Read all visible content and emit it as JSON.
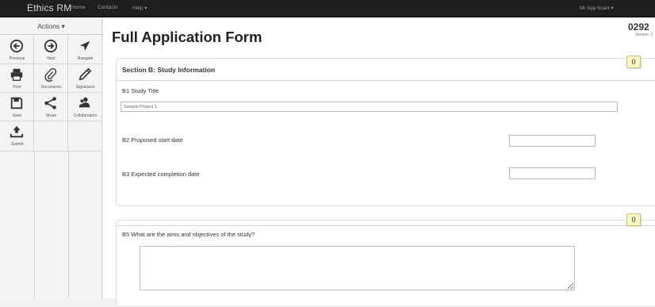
{
  "navbar": {
    "brand": "Ethics RM",
    "links": [
      "Home",
      "Contacts",
      "Help ▾"
    ],
    "user": "Mr App licant ▾"
  },
  "sidebar": {
    "actions_label": "Actions ▾",
    "buttons": [
      {
        "label": "Previous",
        "icon": "arrow-left-circle-icon"
      },
      {
        "label": "Next",
        "icon": "arrow-right-circle-icon"
      },
      {
        "label": "Navigate",
        "icon": "location-arrow-icon"
      },
      {
        "label": "Print",
        "icon": "print-icon"
      },
      {
        "label": "Documents",
        "icon": "paperclip-icon"
      },
      {
        "label": "Signatures",
        "icon": "pencil-icon"
      },
      {
        "label": "Save",
        "icon": "floppy-disk-icon"
      },
      {
        "label": "Share",
        "icon": "share-icon"
      },
      {
        "label": "Collaborators",
        "icon": "collaborators-icon"
      },
      {
        "label": "Submit",
        "icon": "upload-icon"
      }
    ]
  },
  "page": {
    "title": "Full Application Form",
    "app_id": "0292",
    "version": "Version: 2"
  },
  "section_b": {
    "title": "Section B: Study Information",
    "badge": "0",
    "b1_label": "B1  Study Title",
    "b1_value": "Sample Project 1",
    "b2_label": "B2  Proposed start date",
    "b2_value": "",
    "b3_label": "B3  Expected completion date",
    "b3_value": ""
  },
  "section_b5": {
    "badge": "0",
    "b5_label": "B5  What are the aims and objectives of the study?",
    "b5_value": ""
  }
}
